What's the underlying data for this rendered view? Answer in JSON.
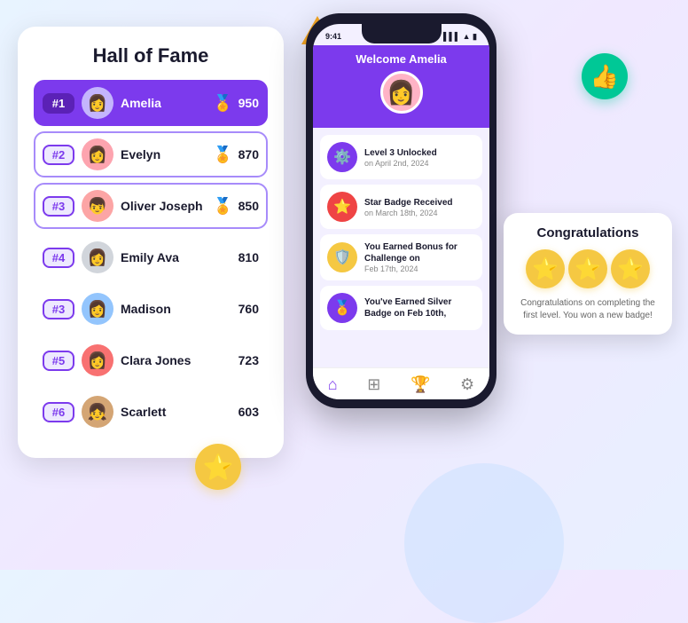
{
  "decorations": {
    "triangle_color": "#f5a623",
    "star_icon": "⭐",
    "thumbs_icon": "👍"
  },
  "hall_of_fame": {
    "title": "Hall of Fame",
    "players": [
      {
        "rank": "#1",
        "name": "Amelia",
        "score": "950",
        "medal": "🥇",
        "avatar": "👩",
        "highlight": true,
        "rank_class": "rank-1"
      },
      {
        "rank": "#2",
        "name": "Evelyn",
        "score": "870",
        "medal": "🥈",
        "avatar": "👩",
        "highlight": false,
        "rank_class": "rank-2"
      },
      {
        "rank": "#3",
        "name": "Oliver Joseph",
        "score": "850",
        "medal": "🥉",
        "avatar": "👦",
        "highlight": false,
        "rank_class": "rank-3"
      },
      {
        "rank": "#4",
        "name": "Emily Ava",
        "score": "810",
        "medal": "",
        "avatar": "👩",
        "highlight": false,
        "rank_class": "rank-other"
      },
      {
        "rank": "#3",
        "name": "Madison",
        "score": "760",
        "medal": "",
        "avatar": "👩",
        "highlight": false,
        "rank_class": "rank-other"
      },
      {
        "rank": "#5",
        "name": "Clara Jones",
        "score": "723",
        "medal": "",
        "avatar": "👩",
        "highlight": false,
        "rank_class": "rank-other"
      },
      {
        "rank": "#6",
        "name": "Scarlett",
        "score": "603",
        "medal": "",
        "avatar": "👧",
        "highlight": false,
        "rank_class": "rank-other"
      }
    ]
  },
  "phone": {
    "time": "9:41",
    "signal": "▌▌▌",
    "wifi": "▲",
    "battery": "🔋",
    "welcome": "Welcome Amelia",
    "activities": [
      {
        "icon": "⚙️",
        "text": "Level 3 Unlocked",
        "date": "on April 2nd, 2024",
        "color": "#7c3aed"
      },
      {
        "icon": "⭐",
        "text": "Star Badge Received",
        "date": "on March 18th, 2024",
        "color": "#ef4444"
      },
      {
        "icon": "🛡️",
        "text": "You Earned Bonus for Challenge on",
        "date": "Feb 17th, 2024",
        "color": "#f5c842"
      },
      {
        "icon": "🏅",
        "text": "You've Earned Silver Badge on Feb 10th,",
        "date": "",
        "color": "#7c3aed"
      }
    ]
  },
  "congratulations": {
    "title": "Congratulations",
    "stars": [
      "⭐",
      "⭐",
      "⭐"
    ],
    "text": "Congratulations on completing the first level. You won a new badge!"
  }
}
